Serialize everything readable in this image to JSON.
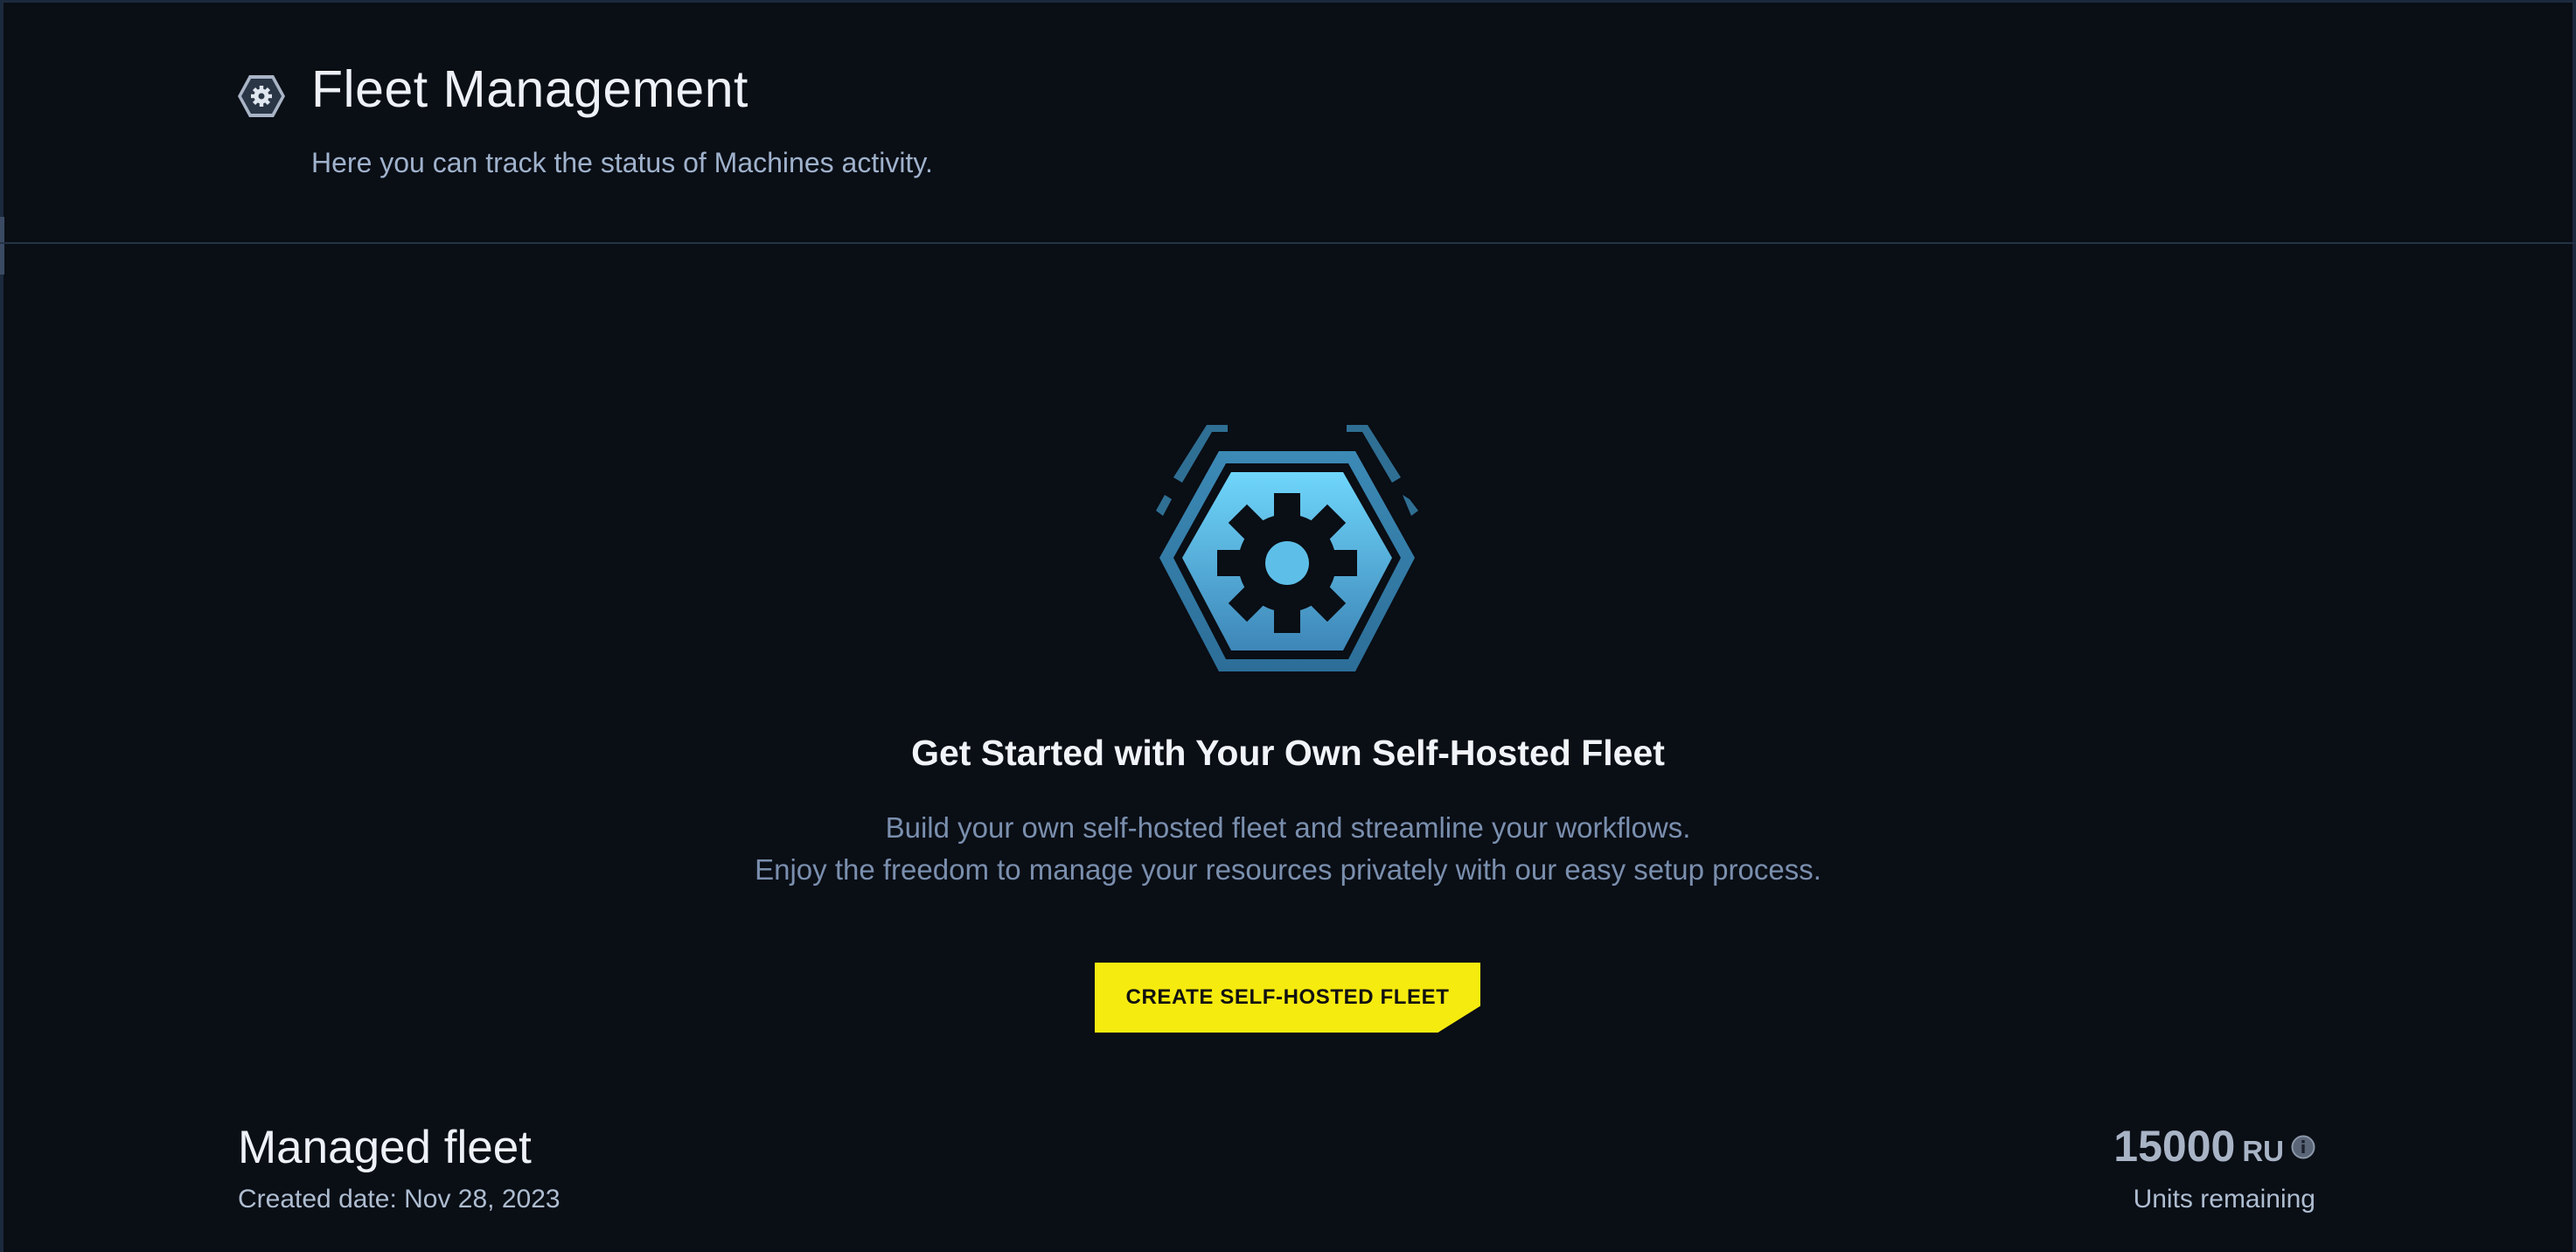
{
  "header": {
    "title": "Fleet Management",
    "subtitle": "Here you can track the status of Machines activity.",
    "icon": "gear-hexagon-icon"
  },
  "empty_state": {
    "icon": "gear-hexagon-icon",
    "title": "Get Started with Your Own Self-Hosted Fleet",
    "description_line1": "Build your own self-hosted fleet and streamline your workflows.",
    "description_line2": "Enjoy the freedom to manage your resources privately with our easy setup process.",
    "button_label": "CREATE SELF-HOSTED FLEET"
  },
  "managed_fleet": {
    "title": "Managed fleet",
    "created": "Created date: Nov 28, 2023",
    "units_value": "15000",
    "units_unit": "RU",
    "units_label": "Units remaining",
    "info_icon": "info-icon"
  },
  "colors": {
    "background": "#0a0e15",
    "accent_button": "#f6eb0f",
    "icon_gradient_top": "#6fd6fb",
    "icon_gradient_bottom": "#3d86b7"
  }
}
